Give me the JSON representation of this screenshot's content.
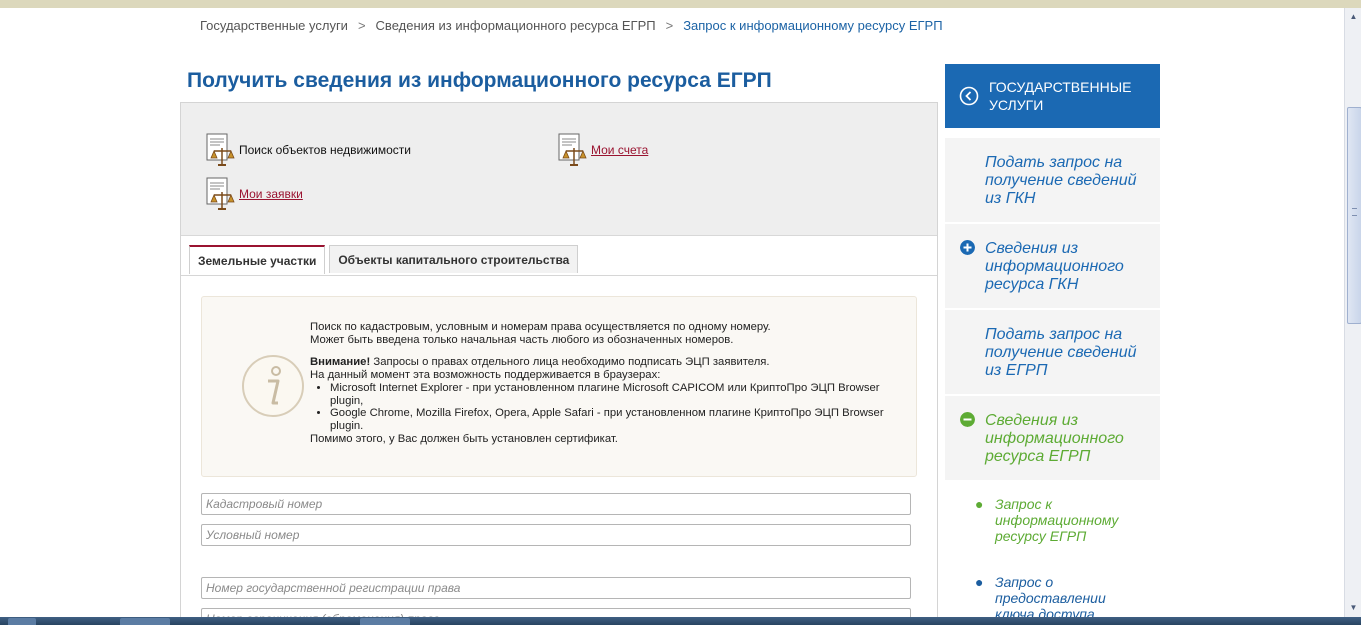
{
  "breadcrumb": {
    "items": [
      "Государственные услуги",
      "Сведения из информационного ресурса ЕГРП",
      "Запрос к информационному ресурсу ЕГРП"
    ],
    "separator": ">"
  },
  "page_title": "Получить сведения из информационного ресурса ЕГРП",
  "menu": {
    "search_label": "Поиск объектов недвижимости",
    "accounts_label": "Мои счета",
    "requests_label": "Мои заявки"
  },
  "tabs": {
    "land": "Земельные участки",
    "capital": "Объекты капитального строительства"
  },
  "info": {
    "line1": "Поиск по кадастровым, условным и номерам права осуществляется по одному номеру.",
    "line2": "Может быть введена только начальная часть любого из обозначенных номеров.",
    "attention_bold": "Внимание!",
    "attention_rest": " Запросы о правах отдельного лица необходимо подписать ЭЦП заявителя.",
    "support_line": "На данный момент эта возможность поддерживается в браузерах:",
    "bullets": [
      "Microsoft Internet Explorer - при установленном плагине Microsoft CAPICOM или КриптоПро ЭЦП Browser plugin,",
      "Google Chrome, Mozilla Firefox, Opera, Apple Safari - при установленном плагине КриптоПро ЭЦП Browser plugin."
    ],
    "footer": "Помимо этого, у Вас должен быть установлен сертификат."
  },
  "fields": {
    "cadastral": "Кадастровый номер",
    "conditional": "Условный номер",
    "reg_number": "Номер государственной регистрации права",
    "encumbrance": "Номер ограничения (обременения) права"
  },
  "sidebar": {
    "header": "ГОСУДАРСТВЕННЫЕ УСЛУГИ",
    "items": [
      "Подать запрос на получение сведений из ГКН",
      "Сведения из информационного ресурса ГКН",
      "Подать запрос на получение сведений из ЕГРП",
      "Сведения из информационного ресурса ЕГРП"
    ],
    "subitems": [
      "Запрос к информационному ресурсу ЕГРП",
      "Запрос о предоставлении ключа доступа"
    ]
  },
  "colors": {
    "brand_blue": "#1b69b3",
    "title_blue": "#1b5d9f",
    "active_green": "#5dab34",
    "link_red": "#9a1330"
  },
  "icons": {
    "menu": "document-scales-icon",
    "info": "info-icon",
    "back": "back-circle-icon",
    "expand": "plus-circle-icon",
    "collapse": "minus-circle-icon"
  }
}
